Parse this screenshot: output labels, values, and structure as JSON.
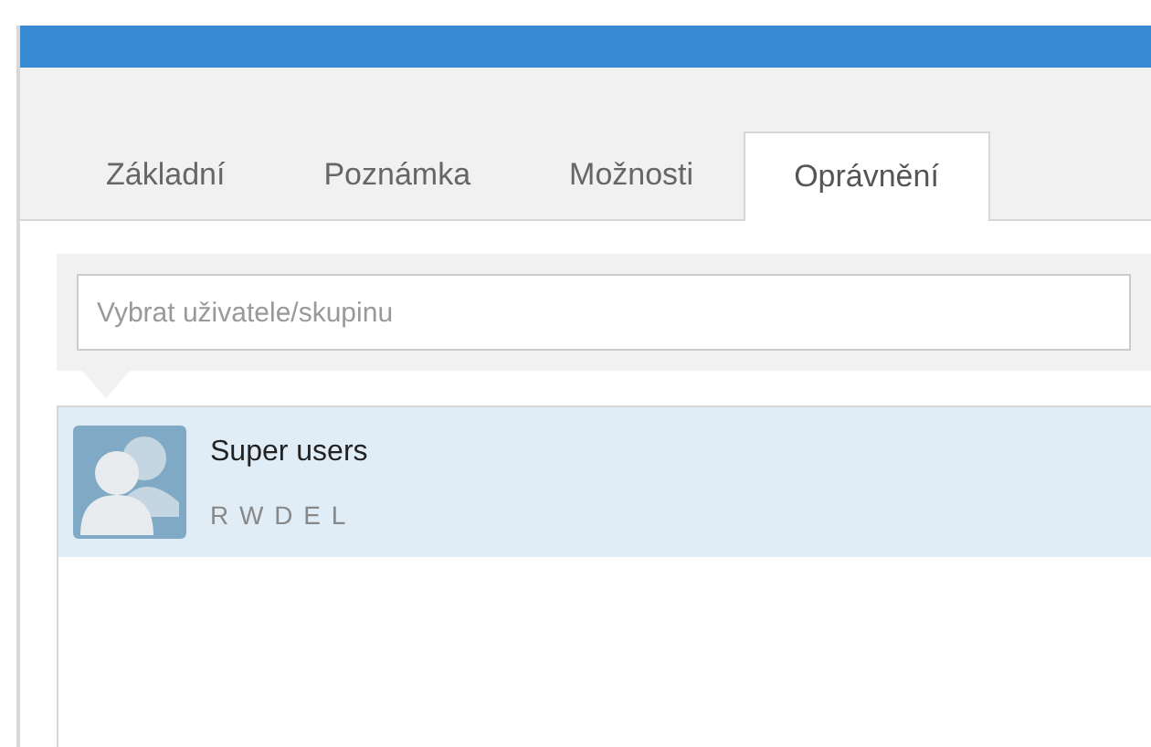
{
  "tabs": [
    {
      "label": "Základní",
      "selected": false
    },
    {
      "label": "Poznámka",
      "selected": false
    },
    {
      "label": "Možnosti",
      "selected": false
    },
    {
      "label": "Oprávnění",
      "selected": true
    }
  ],
  "search": {
    "placeholder": "Vybrat uživatele/skupinu"
  },
  "list": [
    {
      "name": "Super users",
      "permissions": "R W D E L",
      "selected": true
    }
  ]
}
